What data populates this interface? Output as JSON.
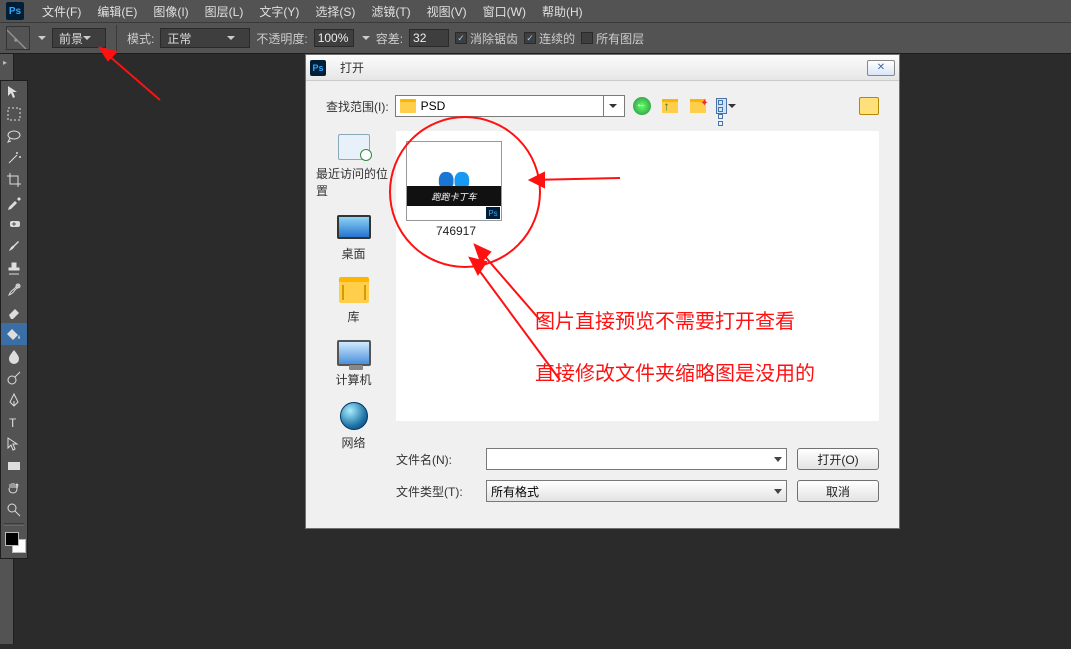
{
  "menubar": [
    "文件(F)",
    "编辑(E)",
    "图像(I)",
    "图层(L)",
    "文字(Y)",
    "选择(S)",
    "滤镜(T)",
    "视图(V)",
    "窗口(W)",
    "帮助(H)"
  ],
  "options": {
    "fill": "前景",
    "mode_label": "模式:",
    "mode_value": "正常",
    "opacity_label": "不透明度:",
    "opacity_value": "100%",
    "tolerance_label": "容差:",
    "tolerance_value": "32",
    "check1": "消除锯齿",
    "check2": "连续的",
    "check3": "所有图层"
  },
  "dialog": {
    "title": "打开",
    "lookin_label": "查找范围(I):",
    "lookin_value": "PSD",
    "places": [
      {
        "label": "最近访问的位置",
        "ic": "ic-recent"
      },
      {
        "label": "桌面",
        "ic": "ic-desktop"
      },
      {
        "label": "库",
        "ic": "ic-lib"
      },
      {
        "label": "计算机",
        "ic": "ic-comp"
      },
      {
        "label": "网络",
        "ic": "ic-net"
      }
    ],
    "file": {
      "name": "746917",
      "band": "跑跑卡丁车"
    },
    "filename_label": "文件名(N):",
    "filename_value": "",
    "filetype_label": "文件类型(T):",
    "filetype_value": "所有格式",
    "open_btn": "打开(O)",
    "cancel_btn": "取消"
  },
  "annotations": {
    "line1": "图片直接预览不需要打开查看",
    "line2": "直接修改文件夹缩略图是没用的"
  }
}
